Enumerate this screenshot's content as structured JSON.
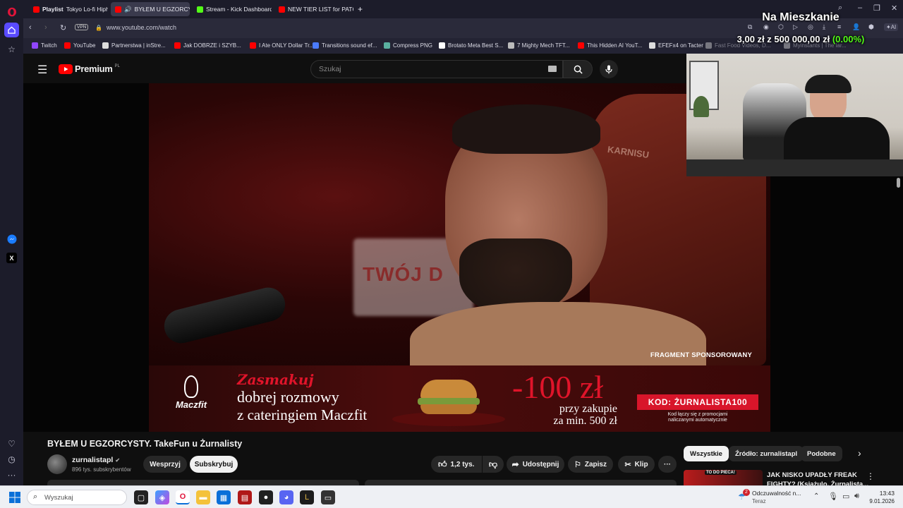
{
  "tabs": [
    {
      "prefix": "Playlist",
      "title": "Tokyo Lo-fi Hiphop",
      "color": "#ff0000",
      "active": false
    },
    {
      "prefix": "",
      "title": "BYŁEM U EGZORCYSTY",
      "color": "#ff0000",
      "active": true
    },
    {
      "prefix": "",
      "title": "Stream - Kick Dashboard",
      "color": "#53fc18",
      "active": false
    },
    {
      "prefix": "",
      "title": "NEW TIER LIST for PATCH",
      "color": "#ff0000",
      "active": false
    }
  ],
  "address_bar": {
    "vpn": "VPN",
    "url": "www.youtube.com/watch"
  },
  "toolbar_ai": "AI",
  "bookmarks": [
    {
      "label": "Twitch",
      "color": "#9146ff"
    },
    {
      "label": "YouTube",
      "color": "#ff0000"
    },
    {
      "label": "Partnerstwa | inStre...",
      "color": "#dddddd"
    },
    {
      "label": "Jak DOBRZE i SZYB...",
      "color": "#ff0000"
    },
    {
      "label": "I Ate ONLY Dollar Tr...",
      "color": "#ff0000"
    },
    {
      "label": "Transitions sound ef...",
      "color": "#4a7bff"
    },
    {
      "label": "Compress PNG",
      "color": "#5ab0a0"
    },
    {
      "label": "Brotato Meta Best S...",
      "color": "#ffffff"
    },
    {
      "label": "7 Mighty Mech TFT...",
      "color": "#bbbbbb"
    },
    {
      "label": "This Hidden AI YouT...",
      "color": "#ff0000"
    },
    {
      "label": "EFEFx4 on Tacter",
      "color": "#dddddd"
    },
    {
      "label": "Fast Food Videos, D...",
      "color": "#dddddd"
    },
    {
      "label": "Myinstants | The lar...",
      "color": "#dddddd"
    }
  ],
  "youtube": {
    "logo": "Premium",
    "logo_sup": "PL",
    "search_placeholder": "Szukaj"
  },
  "video": {
    "sign_text": "TWÓJ D",
    "chair_text": "KARNISU",
    "sponsor_label": "FRAGMENT SPONSOROWANY"
  },
  "ad": {
    "brand": "Maczfit",
    "script": "Zasmakuj",
    "line1": "dobrej rozmowy",
    "line2": "z cateringiem Maczfit",
    "discount": "-100 zł",
    "min_line1": "przy zakupie",
    "min_line2": "za min. 500 zł",
    "code": "KOD: ŻURNALISTA100",
    "note_line1": "Kod łączy się z promocjami",
    "note_line2": "naliczanymi automatycznie"
  },
  "video_info": {
    "title": "BYŁEM U EGZORCYSTY. TakeFun u Żurnalisty",
    "channel": "zurnalistapl",
    "subs": "896 tys. subskrybentów",
    "support": "Wesprzyj",
    "subscribe": "Subskrybuj",
    "likes": "1,2 tys.",
    "share": "Udostępnij",
    "save": "Zapisz",
    "clip": "Klip"
  },
  "chips": [
    "Wszystkie",
    "Źródło: zurnalistapl",
    "Podobne"
  ],
  "suggested": {
    "title_line1": "JAK NISKO UPADŁY FREAK",
    "title_line2": "FIGHTY? (Książulo, Żurnalista...",
    "thumb_text": "TO DO PIECA!"
  },
  "stream_overlay": {
    "title": "Na Mieszkanie",
    "goal_current": "3,00 zł",
    "goal_sep": "z",
    "goal_target": "500 000,00 zł",
    "goal_pct": "(0.00%)"
  },
  "taskbar": {
    "search_placeholder": "Wyszukaj",
    "notif_title": "Odczuwalność n...",
    "notif_sub": "Teraz",
    "notif_badge": "2",
    "time": "13:43",
    "date": "9.01.2026"
  }
}
